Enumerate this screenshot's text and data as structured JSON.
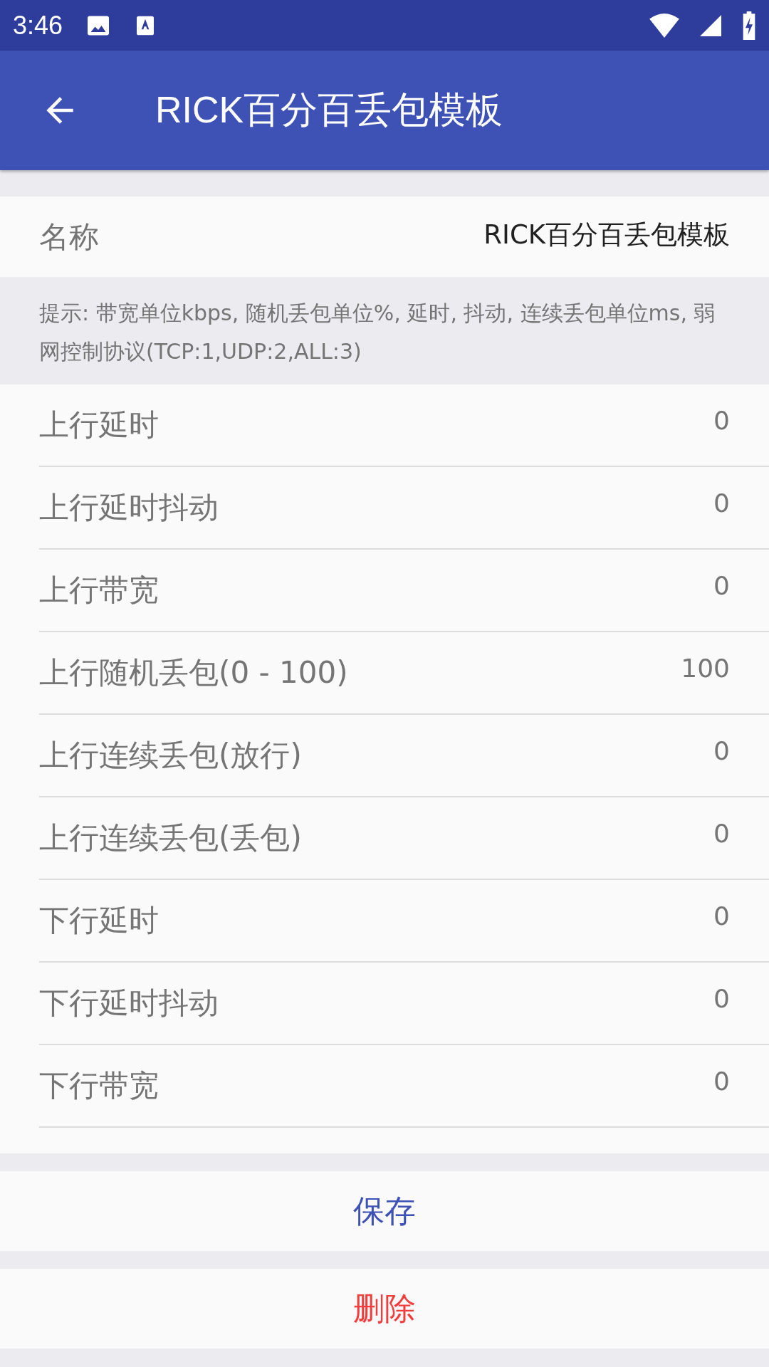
{
  "status_bar": {
    "time": "3:46"
  },
  "toolbar": {
    "title": "RICK百分百丢包模板"
  },
  "name_row": {
    "label": "名称",
    "value": "RICK百分百丢包模板"
  },
  "hint": "提示: 带宽单位kbps, 随机丢包单位%, 延时, 抖动, 连续丢包单位ms, 弱网控制协议(TCP:1,UDP:2,ALL:3)",
  "params": [
    {
      "label": "上行延时",
      "value": "0"
    },
    {
      "label": "上行延时抖动",
      "value": "0"
    },
    {
      "label": "上行带宽",
      "value": "0"
    },
    {
      "label": "上行随机丢包(0 - 100)",
      "value": "100"
    },
    {
      "label": "上行连续丢包(放行)",
      "value": "0"
    },
    {
      "label": "上行连续丢包(丢包)",
      "value": "0"
    },
    {
      "label": "下行延时",
      "value": "0"
    },
    {
      "label": "下行延时抖动",
      "value": "0"
    },
    {
      "label": "下行带宽",
      "value": "0"
    }
  ],
  "buttons": [
    {
      "label": "保存",
      "kind": "primary"
    },
    {
      "label": "删除",
      "kind": "danger"
    }
  ]
}
